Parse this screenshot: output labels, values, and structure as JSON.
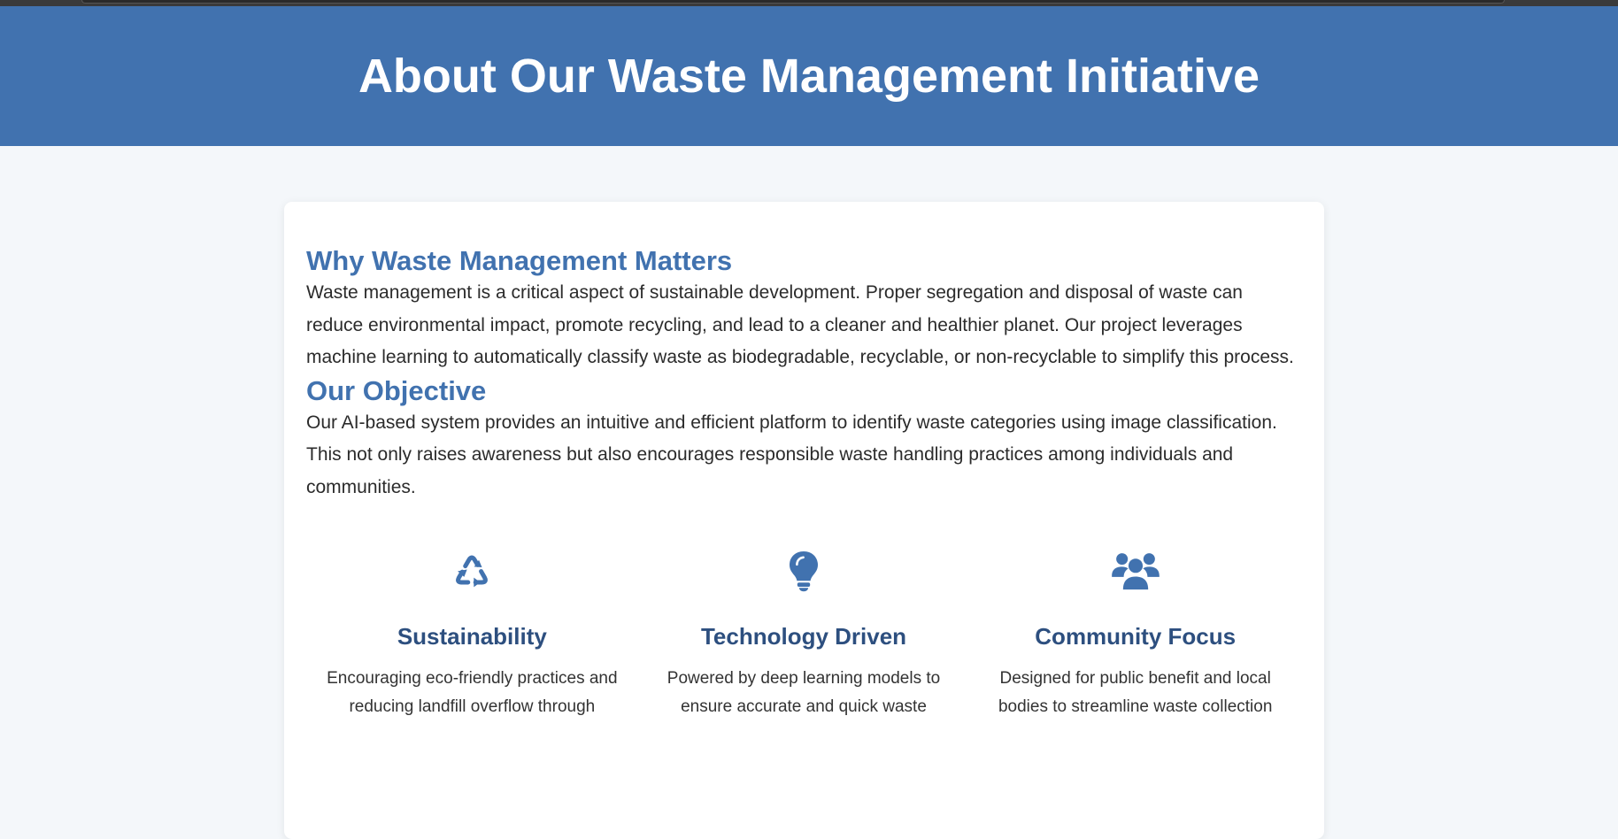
{
  "header": {
    "title": "About Our Waste Management Initiative"
  },
  "sections": [
    {
      "title": "Why Waste Management Matters",
      "text": "Waste management is a critical aspect of sustainable development. Proper segregation and disposal of waste can reduce environmental impact, promote recycling, and lead to a cleaner and healthier planet. Our project leverages machine learning to automatically classify waste as biodegradable, recyclable, or non-recyclable to simplify this process."
    },
    {
      "title": "Our Objective",
      "text": "Our AI-based system provides an intuitive and efficient platform to identify waste categories using image classification. This not only raises awareness but also encourages responsible waste handling practices among individuals and communities."
    }
  ],
  "features": [
    {
      "icon": "recycle-icon",
      "title": "Sustainability",
      "text": "Encouraging eco-friendly practices and reducing landfill overflow through"
    },
    {
      "icon": "lightbulb-icon",
      "title": "Technology Driven",
      "text": "Powered by deep learning models to ensure accurate and quick waste"
    },
    {
      "icon": "users-icon",
      "title": "Community Focus",
      "text": "Designed for public benefit and local bodies to streamline waste collection"
    }
  ],
  "colors": {
    "header_bg": "#4172af",
    "accent": "#4172af",
    "feature_title": "#2d4f7f",
    "page_bg": "#f4f7fa"
  }
}
